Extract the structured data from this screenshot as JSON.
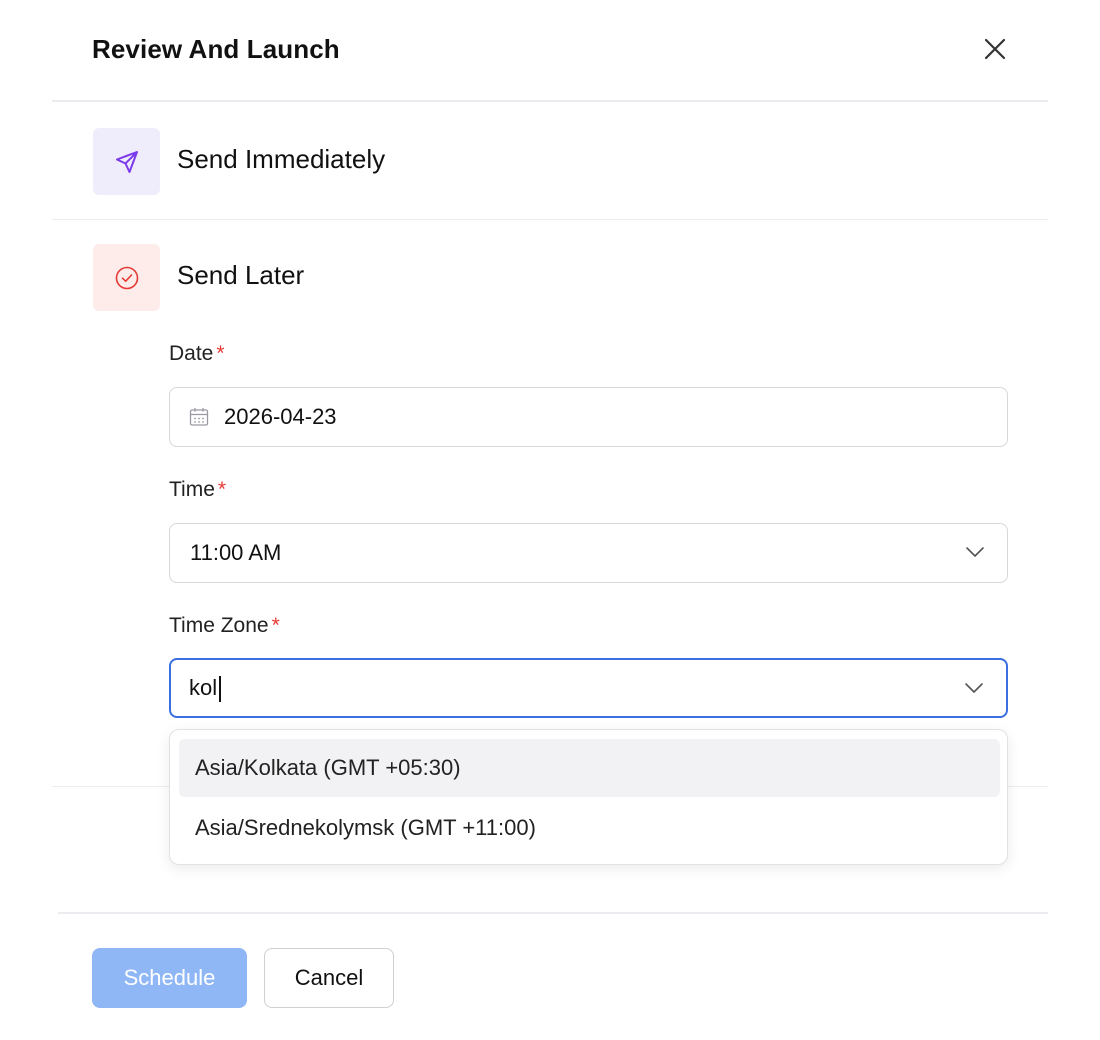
{
  "header": {
    "title": "Review And Launch",
    "close_icon": "close-icon"
  },
  "options": {
    "immediate": {
      "label": "Send Immediately",
      "icon": "send-icon",
      "icon_color": "#7c3aed"
    },
    "later": {
      "label": "Send Later",
      "icon": "check-circle-icon",
      "icon_color": "#e53935"
    }
  },
  "form": {
    "date": {
      "label": "Date",
      "required_mark": "*",
      "value": "2026-04-23",
      "icon": "calendar-icon"
    },
    "time": {
      "label": "Time",
      "required_mark": "*",
      "value": "11:00 AM"
    },
    "timezone": {
      "label": "Time Zone",
      "required_mark": "*",
      "value": "kol"
    }
  },
  "timezone_options": [
    {
      "label": "Asia/Kolkata (GMT +05:30)",
      "highlighted": true
    },
    {
      "label": "Asia/Srednekolymsk (GMT +11:00)",
      "highlighted": false
    }
  ],
  "footer": {
    "primary_label": "Schedule",
    "secondary_label": "Cancel"
  },
  "colors": {
    "accent": "#3b6ee0",
    "primary_button": "#8fb6f5",
    "required": "#e53935"
  }
}
